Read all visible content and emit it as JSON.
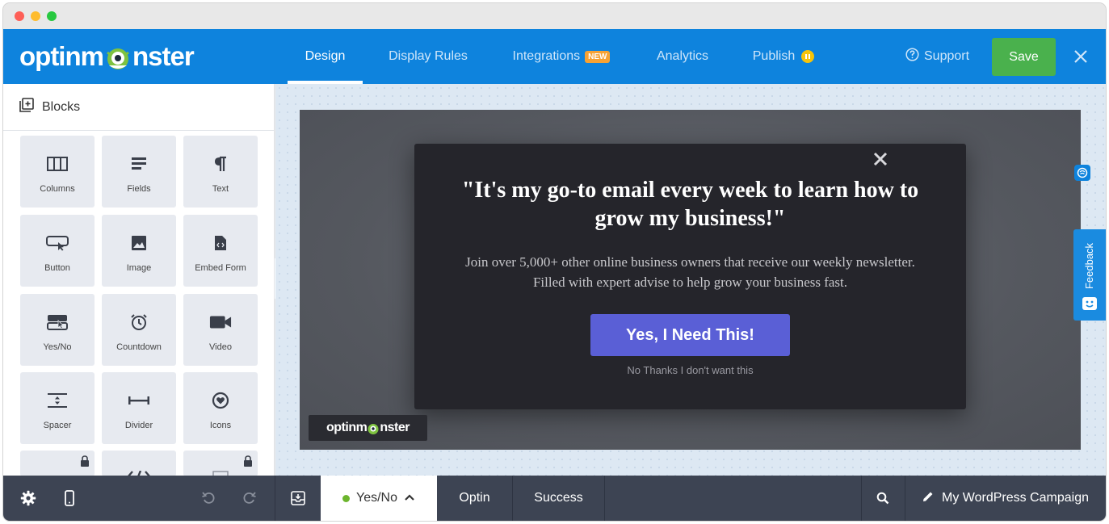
{
  "app": {
    "logo_left": "optinm",
    "logo_right": "nster",
    "footer_logo_left": "optinm",
    "footer_logo_right": "nster"
  },
  "nav": {
    "tabs": [
      {
        "label": "Design",
        "active": true
      },
      {
        "label": "Display Rules"
      },
      {
        "label": "Integrations",
        "badge": "NEW"
      },
      {
        "label": "Analytics"
      },
      {
        "label": "Publish"
      }
    ],
    "support_label": "Support",
    "save_label": "Save"
  },
  "sidebar": {
    "title": "Blocks",
    "blocks": [
      {
        "label": "Columns",
        "icon": "columns-icon"
      },
      {
        "label": "Fields",
        "icon": "fields-icon"
      },
      {
        "label": "Text",
        "icon": "paragraph-icon"
      },
      {
        "label": "Button",
        "icon": "button-icon"
      },
      {
        "label": "Image",
        "icon": "image-icon"
      },
      {
        "label": "Embed Form",
        "icon": "embed-form-icon"
      },
      {
        "label": "Yes/No",
        "icon": "yes-no-icon"
      },
      {
        "label": "Countdown",
        "icon": "countdown-icon"
      },
      {
        "label": "Video",
        "icon": "video-icon"
      },
      {
        "label": "Spacer",
        "icon": "spacer-icon"
      },
      {
        "label": "Divider",
        "icon": "divider-icon"
      },
      {
        "label": "Icons",
        "icon": "icons-icon"
      }
    ]
  },
  "popup": {
    "headline": "\"It's my go-to email every week to learn how to grow my business!\"",
    "subtext_line1": "Join over 5,000+ other online business owners that receive our weekly newsletter.",
    "subtext_line2": "Filled with expert advise to help grow your business fast.",
    "cta_label": "Yes, I Need This!",
    "decline_label": "No Thanks I don't want this"
  },
  "feedback": {
    "label": "Feedback"
  },
  "bottom": {
    "views": [
      {
        "label": "Yes/No",
        "active": true
      },
      {
        "label": "Optin"
      },
      {
        "label": "Success"
      }
    ],
    "campaign_name": "My WordPress Campaign"
  },
  "colors": {
    "nav_blue": "#0e83dd",
    "save_green": "#4ab14d",
    "cta_purple": "#5a5fd6",
    "popup_bg": "#25252b",
    "bottom_bar": "#3d4453",
    "badge_orange": "#f7a233"
  }
}
